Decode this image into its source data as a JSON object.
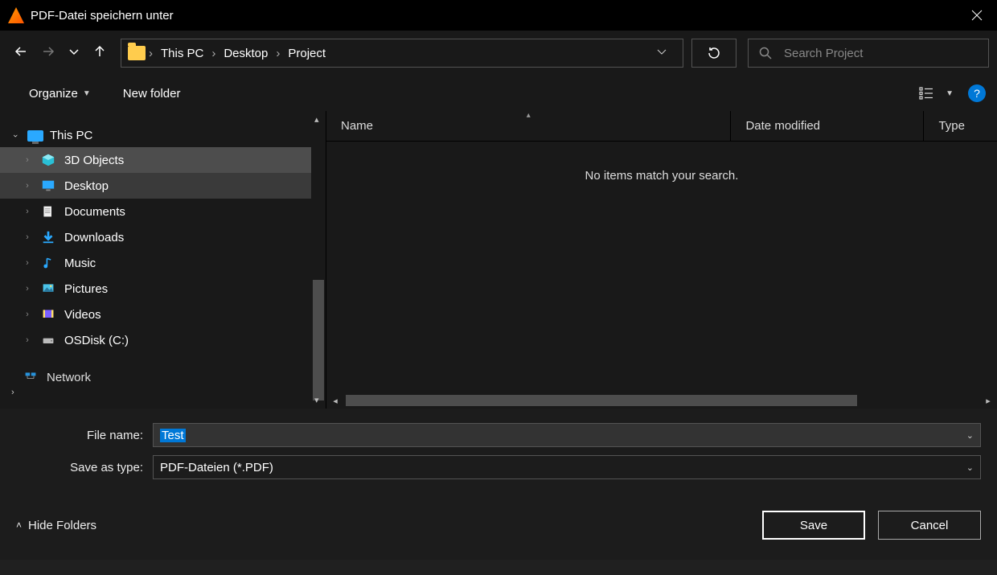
{
  "window": {
    "title": "PDF-Datei speichern unter"
  },
  "breadcrumb": {
    "root": "This PC",
    "segments": [
      "Desktop",
      "Project"
    ]
  },
  "search": {
    "placeholder": "Search Project"
  },
  "toolbar": {
    "organize": "Organize",
    "newfolder": "New folder"
  },
  "tree": {
    "root": "This PC",
    "items": [
      {
        "label": "3D Objects"
      },
      {
        "label": "Desktop"
      },
      {
        "label": "Documents"
      },
      {
        "label": "Downloads"
      },
      {
        "label": "Music"
      },
      {
        "label": "Pictures"
      },
      {
        "label": "Videos"
      },
      {
        "label": "OSDisk (C:)"
      }
    ],
    "network": "Network"
  },
  "columns": {
    "name": "Name",
    "date": "Date modified",
    "type": "Type"
  },
  "content": {
    "empty": "No items match your search."
  },
  "form": {
    "filename_label": "File name:",
    "filename_value": "Test",
    "type_label": "Save as type:",
    "type_value": "PDF-Dateien (*.PDF)"
  },
  "footer": {
    "hide_folders": "Hide Folders",
    "save": "Save",
    "cancel": "Cancel"
  },
  "help_glyph": "?"
}
